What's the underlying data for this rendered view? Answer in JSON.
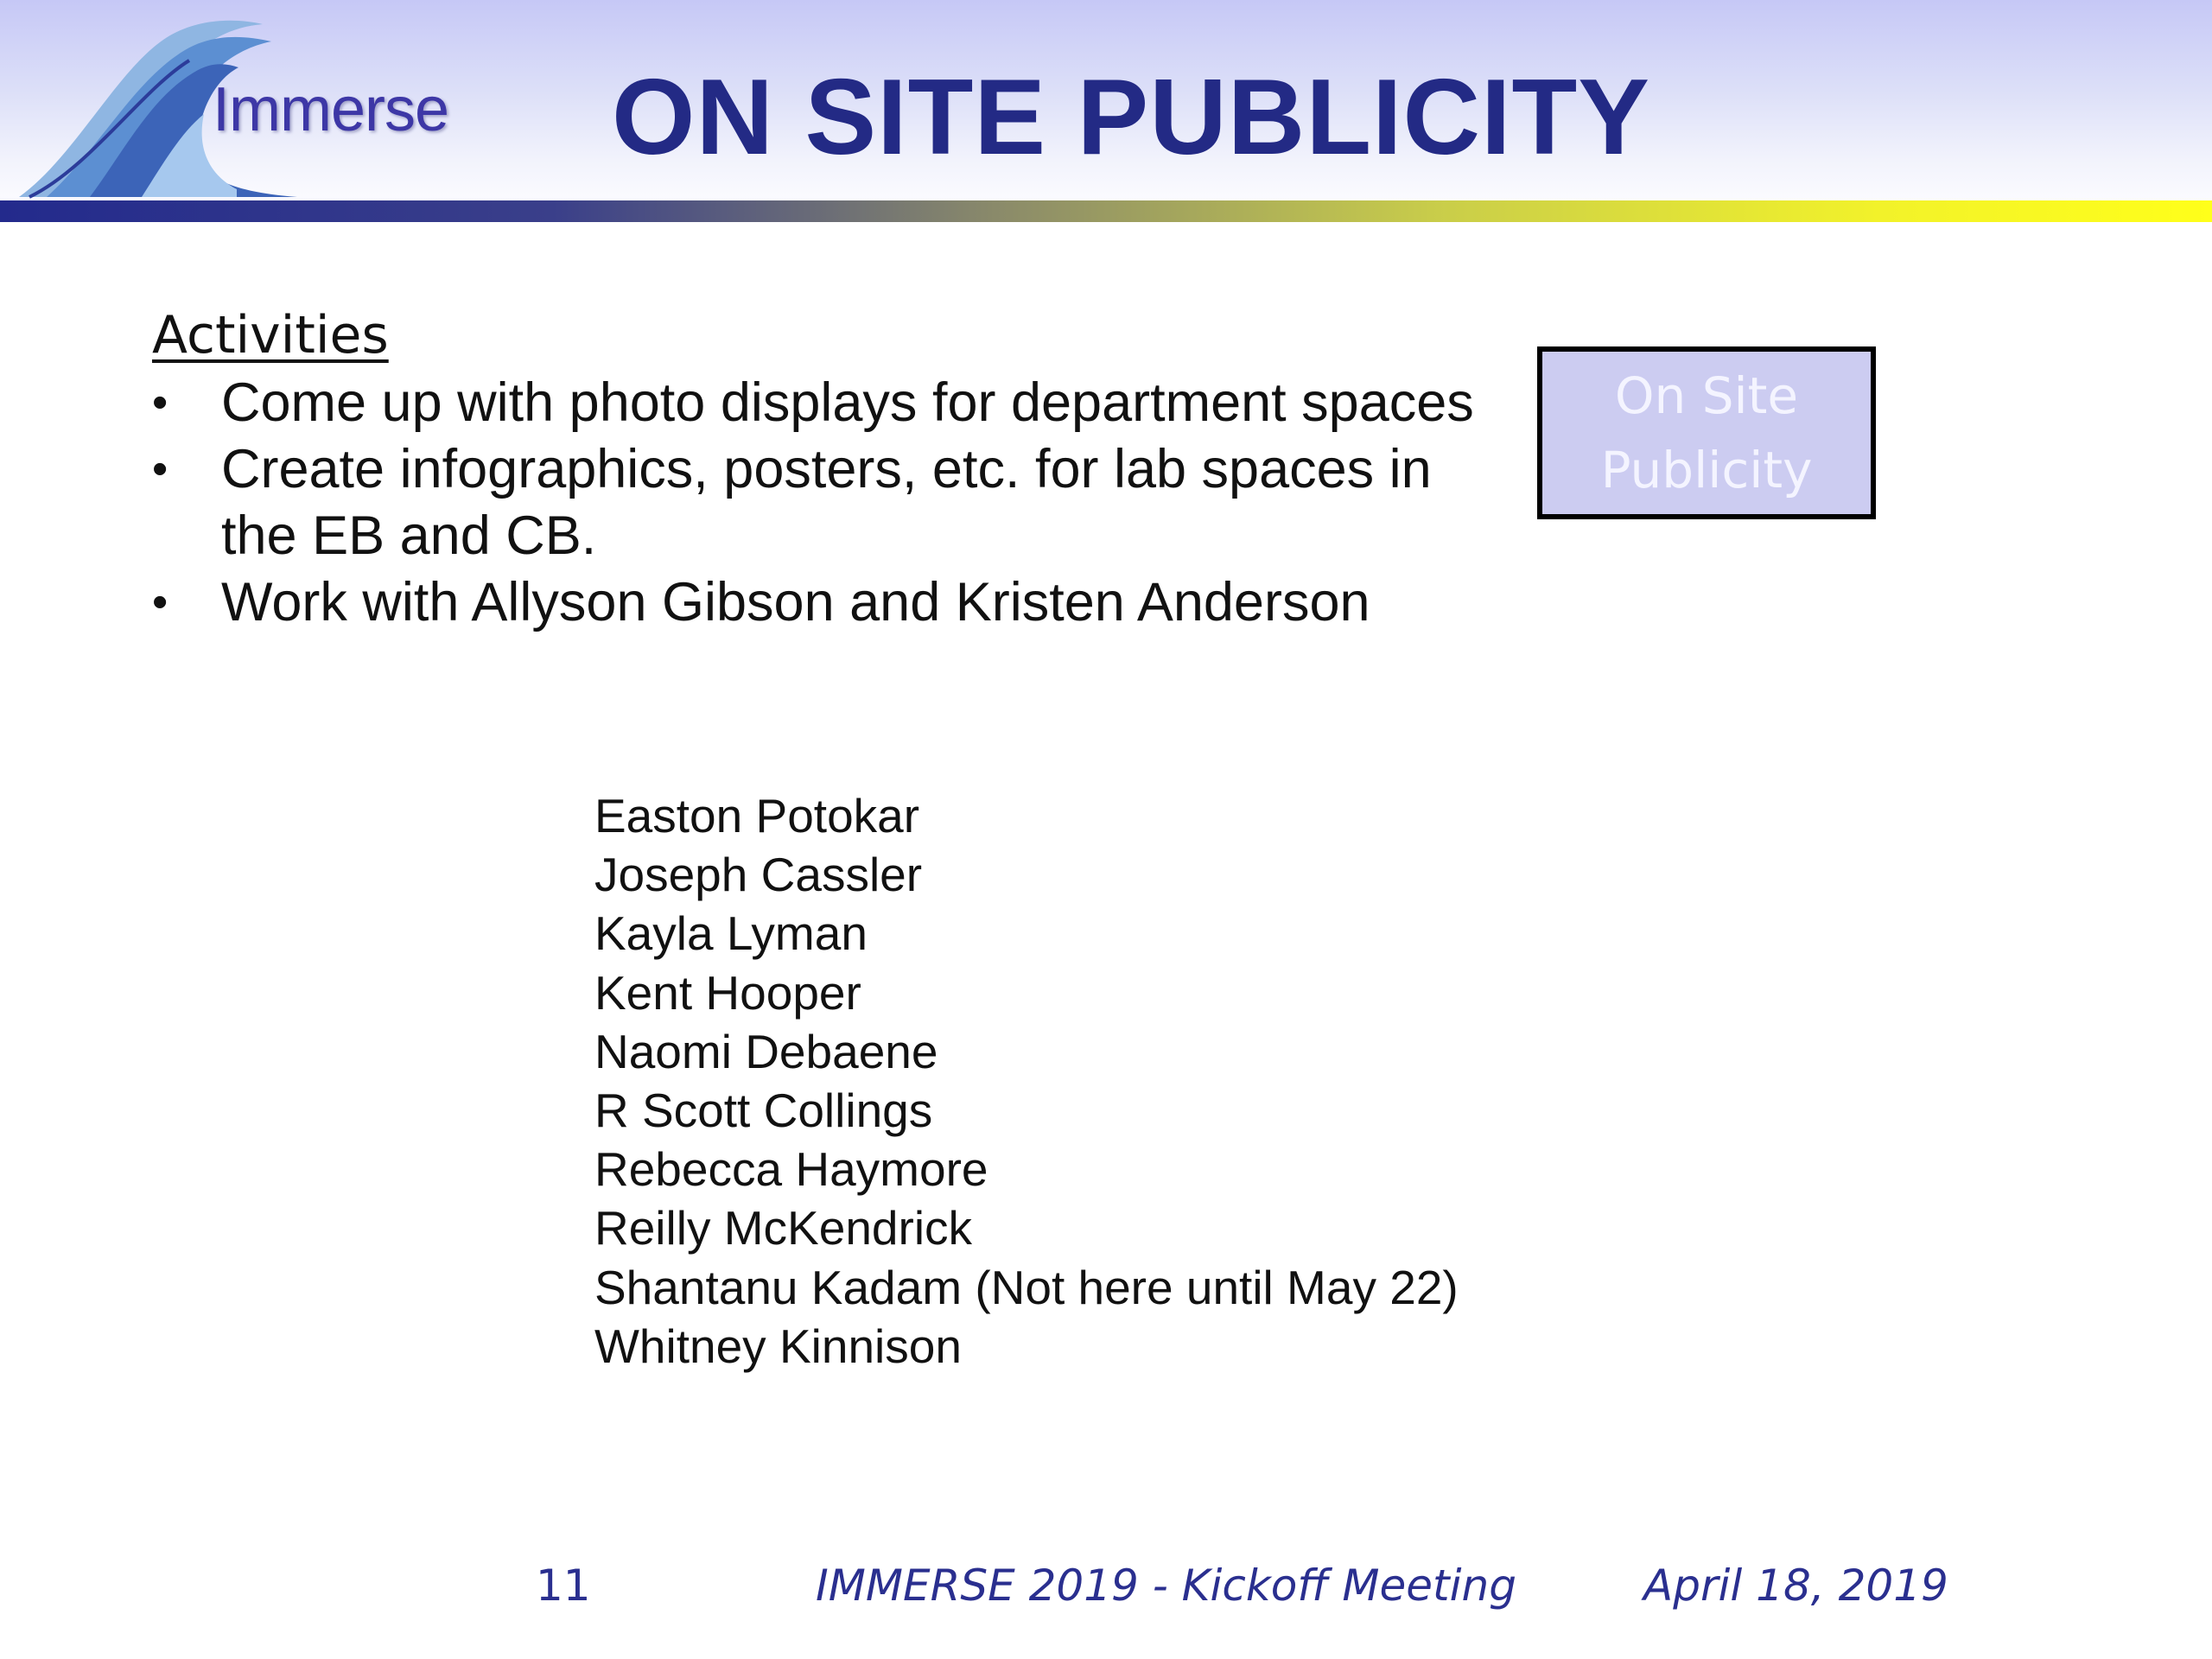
{
  "header": {
    "logo_text": "Immerse",
    "title": "ON SITE PUBLICITY"
  },
  "content": {
    "activities_heading": "Activities",
    "bullets": [
      "Come up with photo displays for department spaces",
      "Create infographics, posters, etc. for lab spaces in the EB and CB.",
      "Work with Allyson Gibson and Kristen Anderson"
    ],
    "bullet_glyph": "•",
    "side_box_label": "On Site Publicity",
    "members": [
      "Easton Potokar",
      "Joseph Cassler",
      "Kayla Lyman",
      "Kent Hooper",
      "Naomi Debaene",
      "R Scott Collings",
      "Rebecca Haymore",
      "Reilly McKendrick",
      "Shantanu Kadam (Not here until May 22)",
      "Whitney Kinnison"
    ]
  },
  "footer": {
    "page_number": "11",
    "event": "IMMERSE 2019 - Kickoff Meeting",
    "date": "April 18, 2019"
  },
  "colors": {
    "title": "#232a85",
    "header_gradient_top": "#c6c8f6",
    "band_left": "#232a8c",
    "band_right": "#ffff1a",
    "side_box_fill": "#ccccf1",
    "footer_text": "#2a2f8f"
  }
}
